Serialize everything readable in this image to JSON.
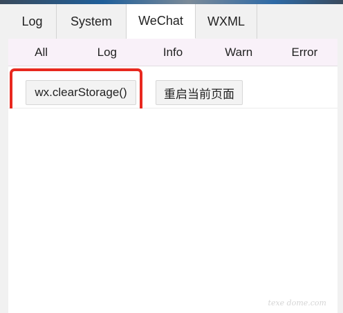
{
  "tabs": [
    {
      "label": "Log",
      "active": false
    },
    {
      "label": "System",
      "active": false
    },
    {
      "label": "WeChat",
      "active": true
    },
    {
      "label": "WXML",
      "active": false
    }
  ],
  "filters": [
    "All",
    "Log",
    "Info",
    "Warn",
    "Error"
  ],
  "toolbar": {
    "clear_storage_label": "wx.clearStorage()",
    "reload_page_label": "重启当前页面"
  },
  "highlight_color": "#e8281f",
  "watermark": "texe dome.com"
}
